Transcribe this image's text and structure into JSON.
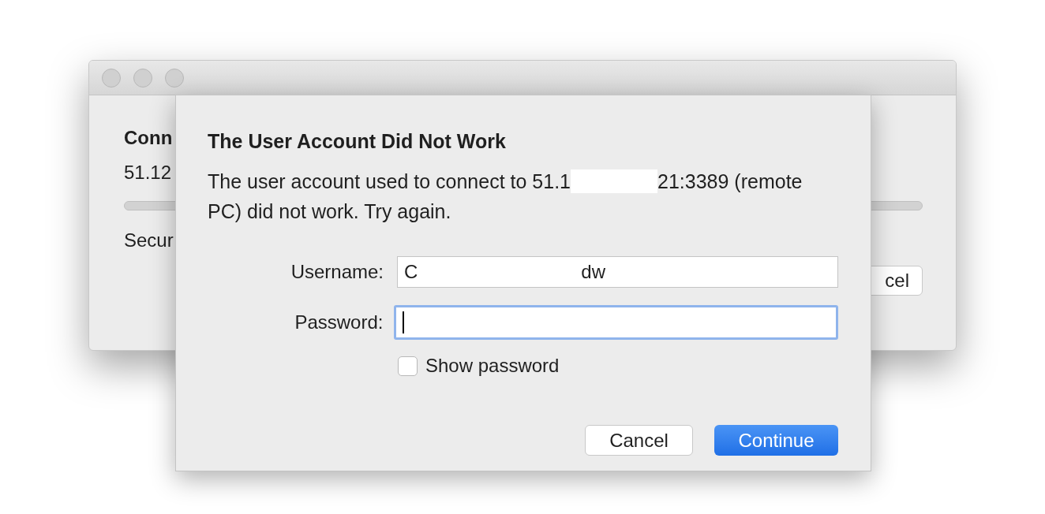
{
  "background_window": {
    "heading": "Conn",
    "address": "51.12",
    "status": "Secur",
    "button": "cel"
  },
  "dialog": {
    "title": "The User Account Did Not Work",
    "message_parts": [
      "The user account used to connect to 51.1",
      "21:3389 (remote",
      "PC) did not work. Try again."
    ],
    "fields": [
      {
        "label": "Username:",
        "value_parts": [
          "C",
          "dw"
        ],
        "focused": false
      },
      {
        "label": "Password:",
        "focused": true
      }
    ],
    "show_password": {
      "label": "Show password",
      "checked": false
    },
    "buttons": [
      {
        "label": "Cancel",
        "kind": "secondary"
      },
      {
        "label": "Continue",
        "kind": "primary"
      }
    ]
  }
}
